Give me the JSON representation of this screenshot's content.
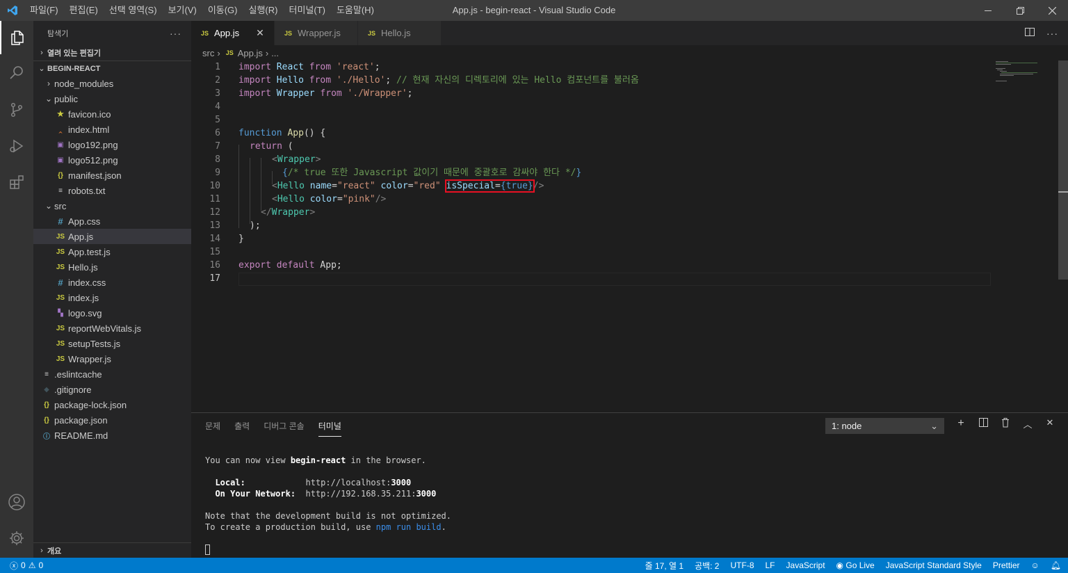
{
  "window": {
    "title": "App.js - begin-react - Visual Studio Code",
    "menu": [
      "파일(F)",
      "편집(E)",
      "선택 영역(S)",
      "보기(V)",
      "이동(G)",
      "실행(R)",
      "터미널(T)",
      "도움말(H)"
    ]
  },
  "sidebar": {
    "title": "탐색기",
    "more": "···",
    "open_editors": "열려 있는 편집기",
    "project": "BEGIN-REACT",
    "outline": "개요",
    "tree": [
      {
        "label": "node_modules",
        "type": "folder-closed",
        "icon": "",
        "indent": 1
      },
      {
        "label": "public",
        "type": "folder-open",
        "icon": "",
        "indent": 1
      },
      {
        "label": "favicon.ico",
        "type": "file",
        "icon": "★",
        "indent": 2
      },
      {
        "label": "index.html",
        "type": "file",
        "icon": "‸",
        "indent": 2
      },
      {
        "label": "logo192.png",
        "type": "file",
        "icon": "▣",
        "indent": 2
      },
      {
        "label": "logo512.png",
        "type": "file",
        "icon": "▣",
        "indent": 2
      },
      {
        "label": "manifest.json",
        "type": "file",
        "icon": "{}",
        "indent": 2
      },
      {
        "label": "robots.txt",
        "type": "file",
        "icon": "≡",
        "indent": 2
      },
      {
        "label": "src",
        "type": "folder-open",
        "icon": "",
        "indent": 1
      },
      {
        "label": "App.css",
        "type": "file",
        "icon": "#",
        "indent": 2
      },
      {
        "label": "App.js",
        "type": "file",
        "icon": "JS",
        "indent": 2,
        "selected": true
      },
      {
        "label": "App.test.js",
        "type": "file",
        "icon": "JS",
        "indent": 2
      },
      {
        "label": "Hello.js",
        "type": "file",
        "icon": "JS",
        "indent": 2
      },
      {
        "label": "index.css",
        "type": "file",
        "icon": "#",
        "indent": 2
      },
      {
        "label": "index.js",
        "type": "file",
        "icon": "JS",
        "indent": 2
      },
      {
        "label": "logo.svg",
        "type": "file",
        "icon": "▚",
        "indent": 2
      },
      {
        "label": "reportWebVitals.js",
        "type": "file",
        "icon": "JS",
        "indent": 2
      },
      {
        "label": "setupTests.js",
        "type": "file",
        "icon": "JS",
        "indent": 2
      },
      {
        "label": "Wrapper.js",
        "type": "file",
        "icon": "JS",
        "indent": 2
      },
      {
        "label": ".eslintcache",
        "type": "file",
        "icon": "≡",
        "indent": 1
      },
      {
        "label": ".gitignore",
        "type": "file",
        "icon": "◆",
        "indent": 1
      },
      {
        "label": "package-lock.json",
        "type": "file",
        "icon": "{}",
        "indent": 1
      },
      {
        "label": "package.json",
        "type": "file",
        "icon": "{}",
        "indent": 1
      },
      {
        "label": "README.md",
        "type": "file",
        "icon": "ⓘ",
        "indent": 1
      }
    ]
  },
  "tabs": [
    {
      "label": "App.js",
      "badge": "JS",
      "active": true,
      "close": "✕"
    },
    {
      "label": "Wrapper.js",
      "badge": "JS"
    },
    {
      "label": "Hello.js",
      "badge": "JS"
    }
  ],
  "breadcrumb": {
    "folder": "src",
    "badge": "JS",
    "file": "App.js",
    "more": "..."
  },
  "code": {
    "line_numbers": [
      "1",
      "2",
      "3",
      "4",
      "5",
      "6",
      "7",
      "8",
      "9",
      "10",
      "11",
      "12",
      "13",
      "14",
      "15",
      "16",
      "17"
    ],
    "current_line": "17",
    "l1": {
      "a": "import",
      "b": " React ",
      "c": "from",
      "d": " 'react'",
      "e": ";"
    },
    "l2": {
      "a": "import",
      "b": " Hello ",
      "c": "from",
      "d": " './Hello'",
      "e": "; ",
      "f": "// 현재 자신의 디렉토리에 있는 Hello 컴포넌트를 불러옴"
    },
    "l3": {
      "a": "import",
      "b": " Wrapper ",
      "c": "from",
      "d": " './Wrapper'",
      "e": ";"
    },
    "l6": {
      "a": "function",
      "b": " App",
      "c": "() {"
    },
    "l7": {
      "a": "return",
      "b": " ("
    },
    "l8": {
      "a": "<",
      "b": "Wrapper",
      "c": ">"
    },
    "l9": {
      "a": "{",
      "b": "/* true 또한 Javascript 값이기 때문에 중괄호로 감싸야 한다 */",
      "c": "}"
    },
    "l10": {
      "a": "<",
      "b": "Hello",
      "c": " name",
      "d": "=",
      "e": "\"react\"",
      "f": " color",
      "g": "=",
      "h": "\"red\"",
      "i": " ",
      "j": "isSpecial",
      "k": "=",
      "l": "{",
      "m": "true",
      "n": "}",
      "o": "/>"
    },
    "l11": {
      "a": "<",
      "b": "Hello",
      "c": " color",
      "d": "=",
      "e": "\"pink\"",
      "f": "/>"
    },
    "l12": {
      "a": "</",
      "b": "Wrapper",
      "c": ">"
    },
    "l13": {
      "a": ");"
    },
    "l14": {
      "a": "}"
    },
    "l16": {
      "a": "export",
      "b": " default",
      "c": " App",
      "d": ";"
    }
  },
  "panel": {
    "tabs": [
      "문제",
      "출력",
      "디버그 콘솔",
      "터미널"
    ],
    "active_tab": "터미널",
    "terminal_select": "1: node",
    "terminal": {
      "t1a": "You can now view ",
      "t1b": "begin-react",
      "t1c": " in the browser.",
      "local_label": "  Local:",
      "local_url": "            http://localhost:",
      "local_port": "3000",
      "net_label": "  On Your Network:",
      "net_url": "  http://192.168.35.211:",
      "net_port": "3000",
      "note": "Note that the development build is not optimized.",
      "t5a": "To create a production build, use ",
      "t5b": "npm run build",
      "t5c": "."
    }
  },
  "status": {
    "errors": "0",
    "warnings": "0",
    "position": "줄 17, 열 1",
    "spaces": "공백: 2",
    "encoding": "UTF-8",
    "eol": "LF",
    "language": "JavaScript",
    "golive": "Go Live",
    "style": "JavaScript Standard Style",
    "prettier": "Prettier"
  },
  "colors": {
    "accent": "#007acc",
    "highlight_box": "#e81123"
  }
}
